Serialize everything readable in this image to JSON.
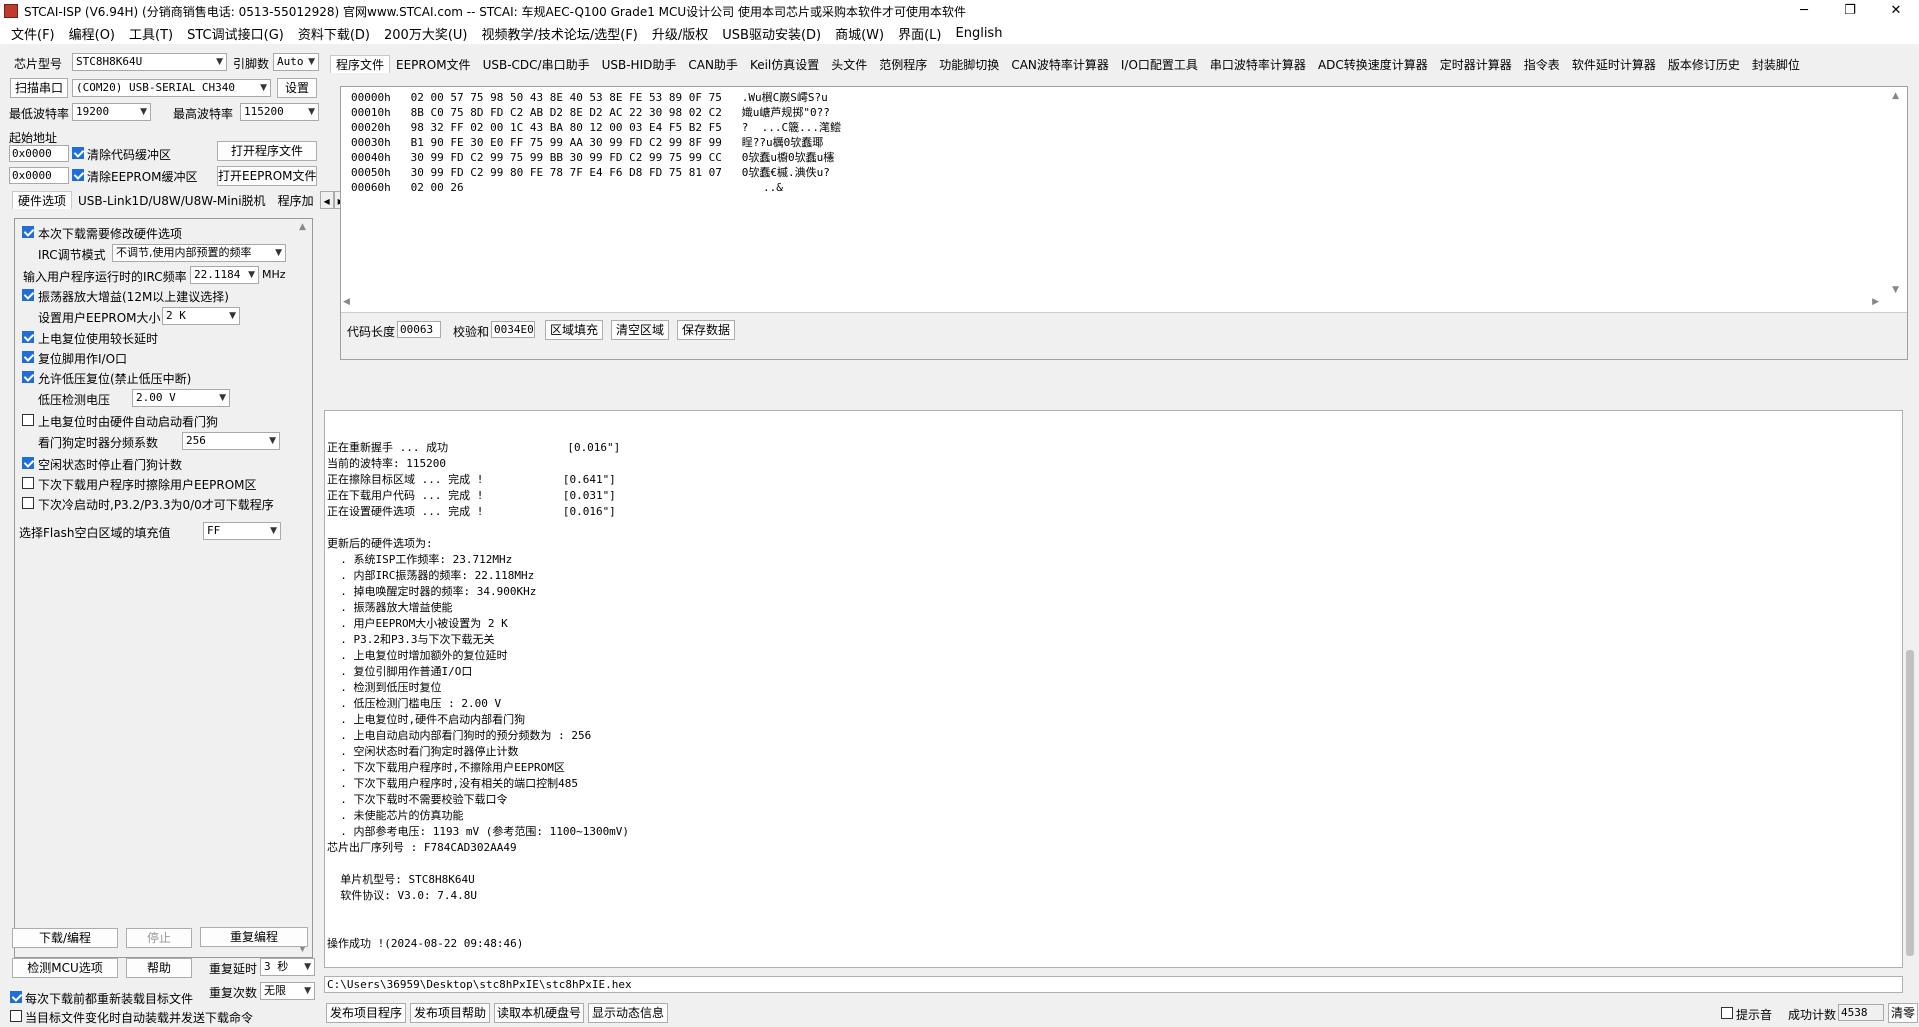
{
  "window": {
    "title": "STCAI-ISP (V6.94H) (分销商销售电话: 0513-55012928) 官网www.STCAI.com  -- STCAI: 车规AEC-Q100 Grade1 MCU设计公司 使用本司芯片或采购本软件才可使用本软件"
  },
  "menu": [
    "文件(F)",
    "编程(O)",
    "工具(T)",
    "STC调试接口(G)",
    "资料下载(D)",
    "200万大奖(U)",
    "视频教学/技术论坛/选型(F)",
    "升级/版权",
    "USB驱动安装(D)",
    "商城(W)",
    "界面(L)",
    "English"
  ],
  "left": {
    "chip_label": "芯片型号",
    "chip_value": "STC8H8K64U",
    "pin_label": "引脚数",
    "pin_value": "Auto",
    "scan_label": "扫描串口",
    "port_value": "(COM20) USB-SERIAL CH340",
    "settings_btn": "设置",
    "min_baud_label": "最低波特率",
    "min_baud": "19200",
    "max_baud_label": "最高波特率",
    "max_baud": "115200",
    "start_addr_label": "起始地址",
    "addr1": "0x0000",
    "clear_code": "清除代码缓冲区",
    "open_prog": "打开程序文件",
    "addr2": "0x0000",
    "clear_eeprom": "清除EEPROM缓冲区",
    "open_eeprom": "打开EEPROM文件",
    "tabs": [
      "硬件选项",
      "USB-Link1D/U8W/U8W-Mini脱机",
      "程序加"
    ],
    "hw": {
      "opt_modify": "本次下载需要修改硬件选项",
      "irc_mode_label": "IRC调节模式",
      "irc_mode": "不调节,使用内部预置的频率",
      "irc_freq_label": "输入用户程序运行时的IRC频率",
      "irc_freq": "22.1184",
      "mhz": "MHz",
      "osc_gain": "振荡器放大增益(12M以上建议选择)",
      "eeprom_size_label": "设置用户EEPROM大小",
      "eeprom_size": "2   K",
      "long_reset": "上电复位使用较长延时",
      "reset_io": "复位脚用作I/O口",
      "lvr": "允许低压复位(禁止低压中断)",
      "lvd_label": "低压检测电压",
      "lvd": "2.00 V",
      "wdt_auto": "上电复位时由硬件自动启动看门狗",
      "wdt_div_label": "看门狗定时器分频系数",
      "wdt_div": "256",
      "idle_wdt": "空闲状态时停止看门狗计数",
      "erase_eeprom": "下次下载用户程序时擦除用户EEPROM区",
      "p32_cold": "下次冷启动时,P3.2/P3.3为0/0才可下载程序",
      "flash_fill_label": "选择Flash空白区域的填充值",
      "flash_fill": "FF"
    },
    "download_btn": "下载/编程",
    "stop_btn": "停止",
    "reprog_btn": "重复编程",
    "detect_btn": "检测MCU选项",
    "help_btn": "帮助",
    "repeat_delay_label": "重复延时",
    "repeat_delay": "3 秒",
    "reload_label": "每次下载前都重新装载目标文件",
    "repeat_count_label": "重复次数",
    "repeat_count": "无限",
    "auto_load_label": "当目标文件变化时自动装载并发送下载命令"
  },
  "right_tabs": [
    "程序文件",
    "EEPROM文件",
    "USB-CDC/串口助手",
    "USB-HID助手",
    "CAN助手",
    "Keil仿真设置",
    "头文件",
    "范例程序",
    "功能脚切换",
    "CAN波特率计算器",
    "I/O口配置工具",
    "串口波特率计算器",
    "ADC转换速度计算器",
    "定时器计算器",
    "指令表",
    "软件延时计算器",
    "版本修订历史",
    "封装脚位"
  ],
  "hex_rows": [
    {
      "addr": "00000h",
      "bytes": "02 00 57 75 98 50 43 8E 40 53 8E FE 53 89 0F 75",
      "ascii": ".Wu橮C嶡S嶀S?u"
    },
    {
      "addr": "00010h",
      "bytes": "8B C0 75 8D FD C2 AB D2 8E D2 AC 22 30 98 02 C2",
      "ascii": "嬂u嵣芦规掷\"0??"
    },
    {
      "addr": "00020h",
      "bytes": "98 32 FF 02 00 1C 43 BA 80 12 00 03 E4 F5 B2 F5",
      "ascii": "?  ...C簚...滗鲿"
    },
    {
      "addr": "00030h",
      "bytes": "B1 90 FE 30 E0 FF 75 99 AA 30 99 FD C2 99 8F 99",
      "ascii": "睈??u櫔0欤蠢瑘"
    },
    {
      "addr": "00040h",
      "bytes": "30 99 FD C2 99 75 99 BB 30 99 FD C2 99 75 99 CC",
      "ascii": "0欤蠢u櫥0欤蠢u櫶"
    },
    {
      "addr": "00050h",
      "bytes": "30 99 FD C2 99 80 FE 78 7F E4 F6 D8 FD 75 81 07",
      "ascii": "0欤蠢€槭.淟佚u?"
    },
    {
      "addr": "00060h",
      "bytes": "02 00 26",
      "ascii": "..&"
    }
  ],
  "code_len_label": "代码长度",
  "code_len": "00063",
  "checksum_label": "校验和",
  "checksum": "0034E0",
  "fill_btn": "区域填充",
  "clear_btn": "清空区域",
  "save_btn": "保存数据",
  "log": [
    "正在重新握手 ... 成功                  [0.016\"]",
    "当前的波特率: 115200",
    "正在擦除目标区域 ... 完成 !            [0.641\"]",
    "正在下载用户代码 ... 完成 !            [0.031\"]",
    "正在设置硬件选项 ... 完成 !            [0.016\"]",
    "",
    "更新后的硬件选项为:",
    "  . 系统ISP工作频率: 23.712MHz",
    "  . 内部IRC振荡器的频率: 22.118MHz",
    "  . 掉电唤醒定时器的频率: 34.900KHz",
    "  . 振荡器放大增益使能",
    "  . 用户EEPROM大小被设置为 2 K",
    "  . P3.2和P3.3与下次下载无关",
    "  . 上电复位时增加额外的复位延时",
    "  . 复位引脚用作普通I/O口",
    "  . 检测到低压时复位",
    "  . 低压检测门槛电压 : 2.00 V",
    "  . 上电复位时,硬件不启动内部看门狗",
    "  . 上电自动启动内部看门狗时的预分频数为 : 256",
    "  . 空闲状态时看门狗定时器停止计数",
    "  . 下次下载用户程序时,不擦除用户EEPROM区",
    "  . 下次下载用户程序时,没有相关的端口控制485",
    "  . 下次下载时不需要校验下载口令",
    "  . 未使能芯片的仿真功能",
    "  . 内部参考电压: 1193 mV (参考范围: 1100~1300mV)",
    "芯片出厂序列号 : F784CAD302AA49",
    "",
    "  单片机型号: STC8H8K64U",
    "  软件协议: V3.0: 7.4.8U",
    "",
    "",
    "操作成功 !(2024-08-22 09:48:46)"
  ],
  "path": "C:\\Users\\36959\\Desktop\\stc8hPxIE\\stc8hPxIE.hex",
  "bottom": {
    "publish_prog": "发布项目程序",
    "publish_help": "发布项目帮助",
    "read_disk": "读取本机硬盘号",
    "show_dyn": "显示动态信息",
    "beep": "提示音",
    "success_label": "成功计数",
    "success_count": "4538",
    "clear": "清零"
  }
}
